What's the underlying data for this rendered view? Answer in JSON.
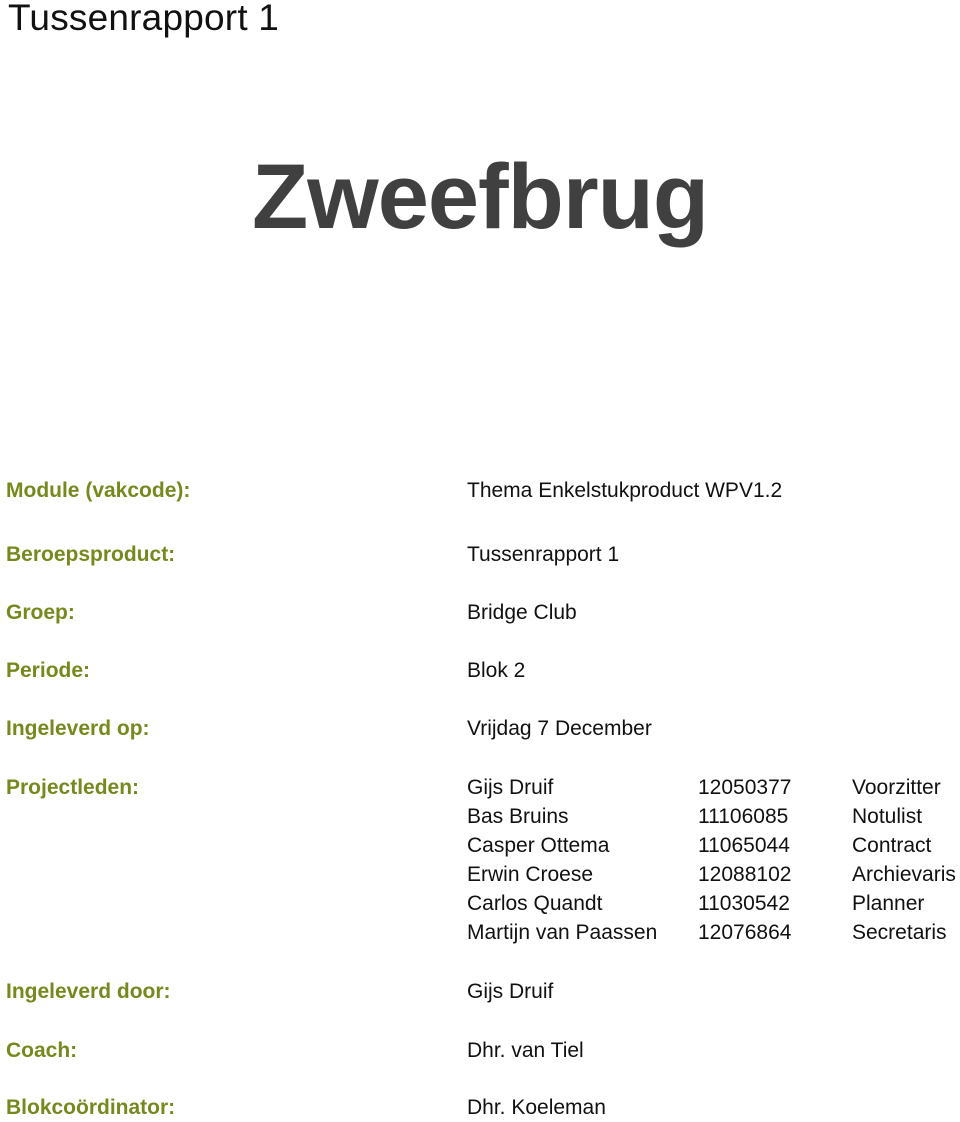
{
  "document": {
    "header_title": "Tussenrapport 1",
    "main_title": "Zweefbrug",
    "label_color": "#76891d",
    "title_color": "#404040"
  },
  "fields": {
    "module": {
      "label": "Module (vakcode):",
      "value": "Thema Enkelstukproduct WPV1.2"
    },
    "beroepsproduct": {
      "label": "Beroepsproduct:",
      "value": "Tussenrapport 1"
    },
    "groep": {
      "label": "Groep:",
      "value": "Bridge Club"
    },
    "periode": {
      "label": "Periode:",
      "value": "Blok 2"
    },
    "ingeleverd_op": {
      "label": "Ingeleverd op:",
      "value": "Vrijdag 7 December"
    },
    "projectleden": {
      "label": "Projectleden:"
    },
    "ingeleverd_door": {
      "label": "Ingeleverd door:",
      "value": "Gijs Druif"
    },
    "coach": {
      "label": "Coach:",
      "value": "Dhr. van Tiel"
    },
    "blokcoordinator": {
      "label": "Blokcoördinator:",
      "value": "Dhr. Koeleman"
    }
  },
  "members": [
    {
      "name": "Gijs Druif",
      "student_number": "12050377",
      "role": "Voorzitter"
    },
    {
      "name": "Bas Bruins",
      "student_number": "11106085",
      "role": "Notulist"
    },
    {
      "name": "Casper Ottema",
      "student_number": "11065044",
      "role": "Contract"
    },
    {
      "name": "Erwin Croese",
      "student_number": "12088102",
      "role": "Archievaris"
    },
    {
      "name": "Carlos Quandt",
      "student_number": "11030542",
      "role": "Planner"
    },
    {
      "name": "Martijn van Paassen",
      "student_number": "12076864",
      "role": "Secretaris"
    }
  ]
}
